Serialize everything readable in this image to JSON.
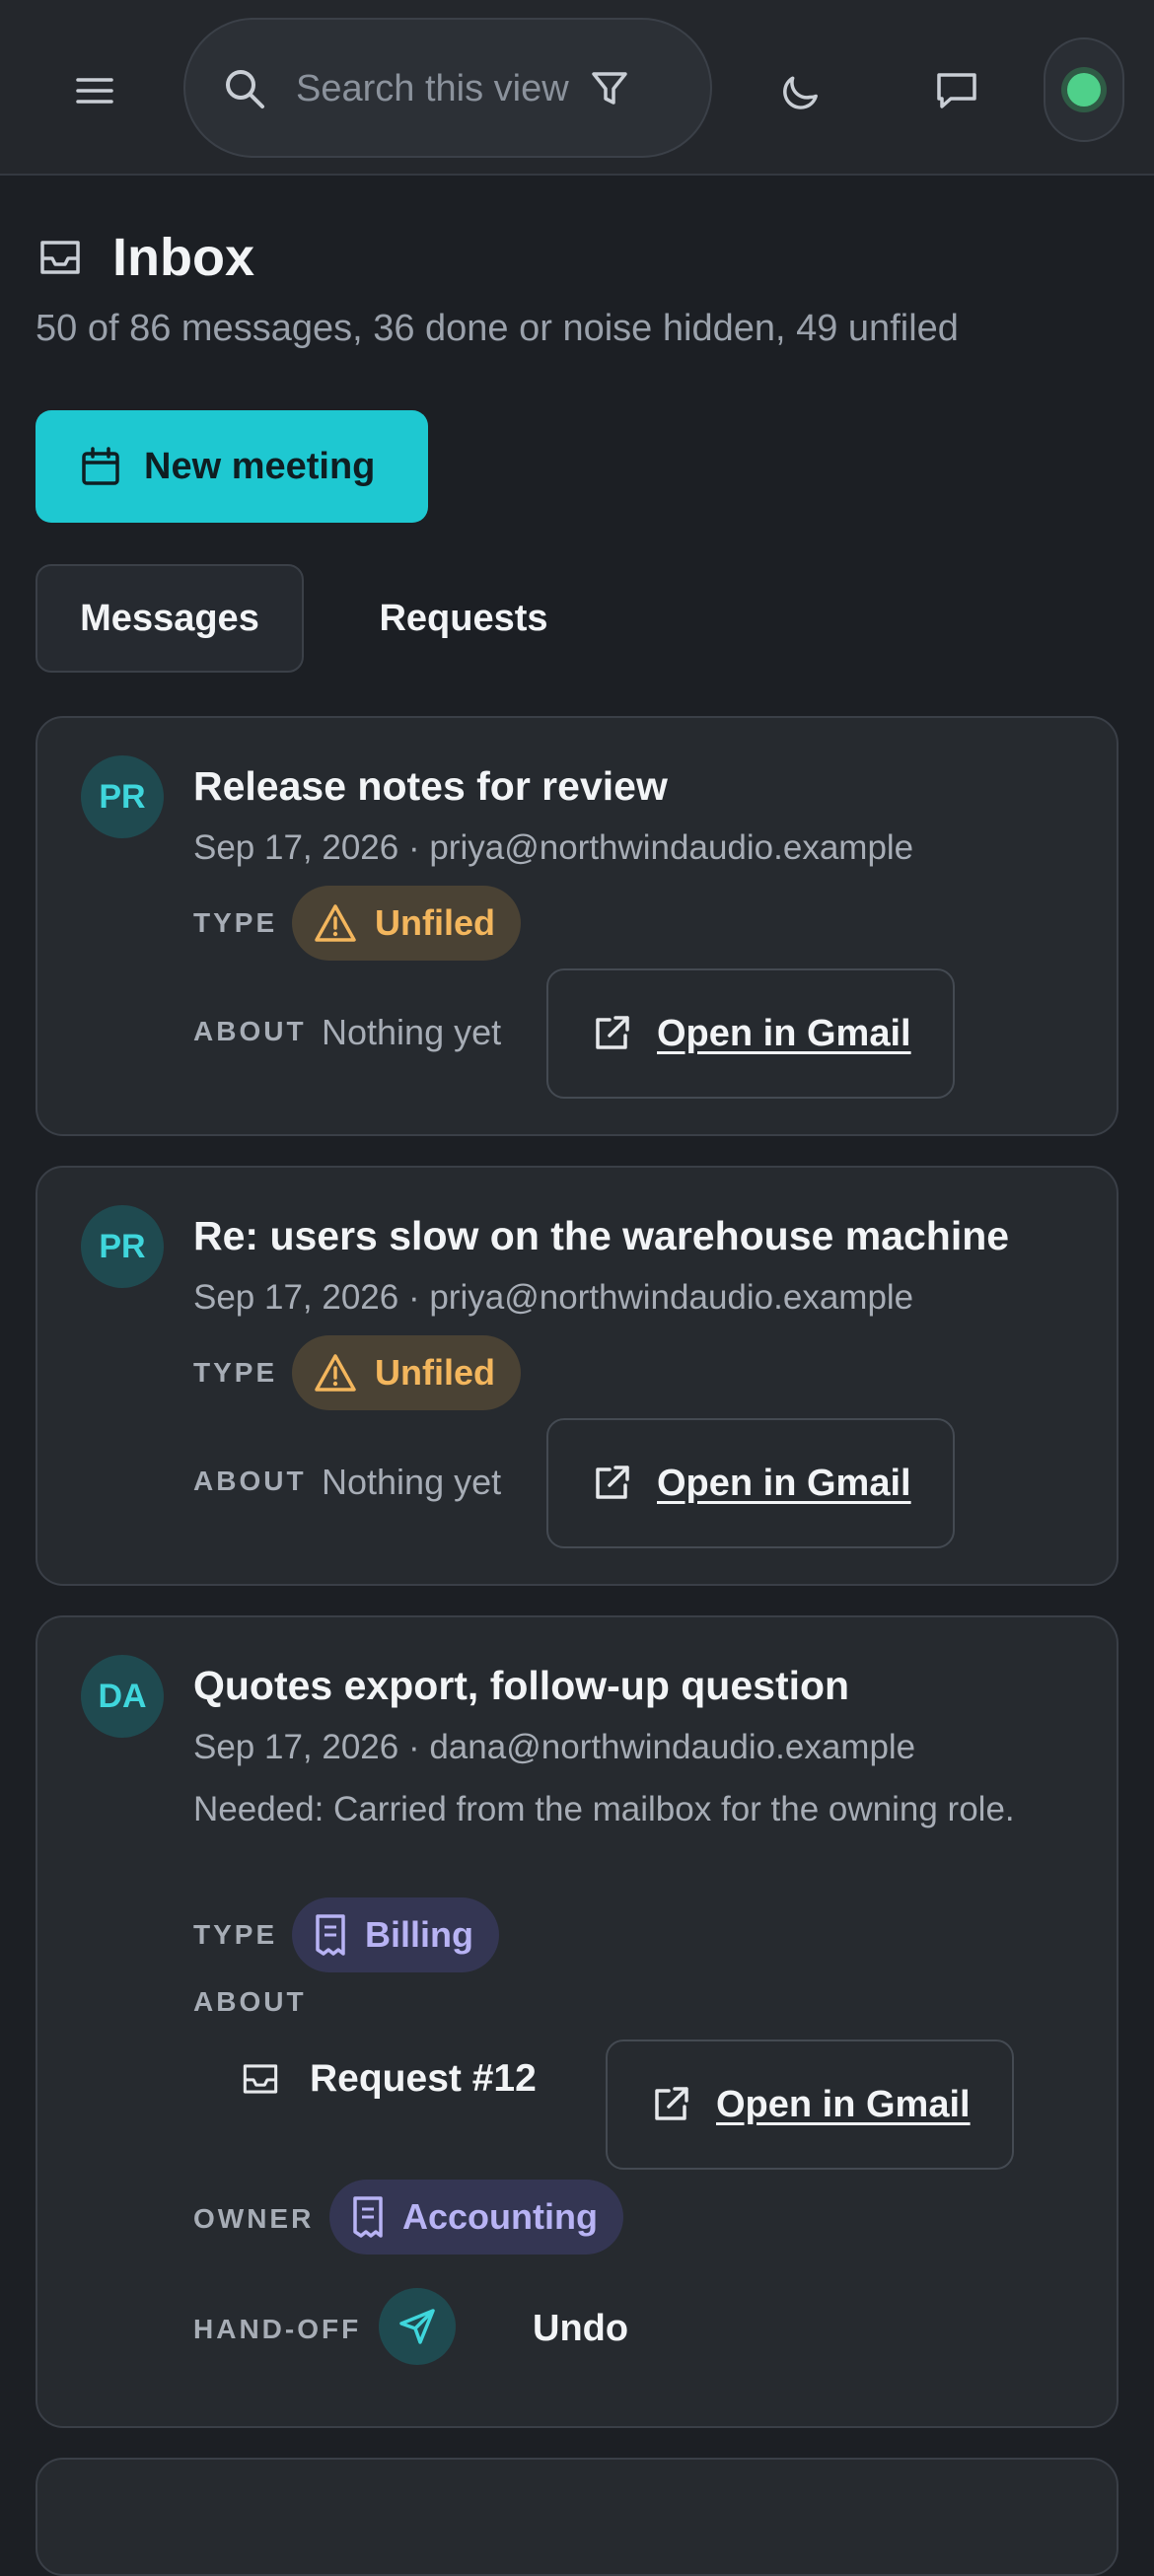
{
  "topbar": {
    "search_placeholder": "Search this view",
    "status_color": "#4fd08a"
  },
  "header": {
    "title": "Inbox",
    "subtitle": "50 of 86 messages, 36 done or noise hidden, 49 unfiled",
    "new_meeting_label": "New meeting"
  },
  "tabs": [
    {
      "label": "Messages",
      "active": true
    },
    {
      "label": "Requests",
      "active": false
    }
  ],
  "labels": {
    "type": "TYPE",
    "about": "ABOUT",
    "owner": "OWNER",
    "handoff": "HAND-OFF"
  },
  "messages": [
    {
      "initials": "PR",
      "subject": "Release notes for review",
      "meta": "Sep 17, 2026 · priya@northwindaudio.example",
      "type_label": "Unfiled",
      "about_text": "Nothing yet",
      "open_label": "Open in Gmail"
    },
    {
      "initials": "PR",
      "subject": "Re: users slow on the warehouse machine",
      "meta": "Sep 17, 2026 · priya@northwindaudio.example",
      "type_label": "Unfiled",
      "about_text": "Nothing yet",
      "open_label": "Open in Gmail"
    },
    {
      "initials": "DA",
      "subject": "Quotes export, follow-up question",
      "meta": "Sep 17, 2026 · dana@northwindaudio.example",
      "needed": "Needed: Carried from the mailbox for the owning role.",
      "type_label": "Billing",
      "about_request": "Request #12",
      "open_label": "Open in Gmail",
      "owner_label": "Accounting",
      "undo_label": "Undo"
    }
  ],
  "colors": {
    "accent": "#1ec8d1",
    "unfiled": "#f3b65d",
    "billing": "#b8b3f4"
  }
}
